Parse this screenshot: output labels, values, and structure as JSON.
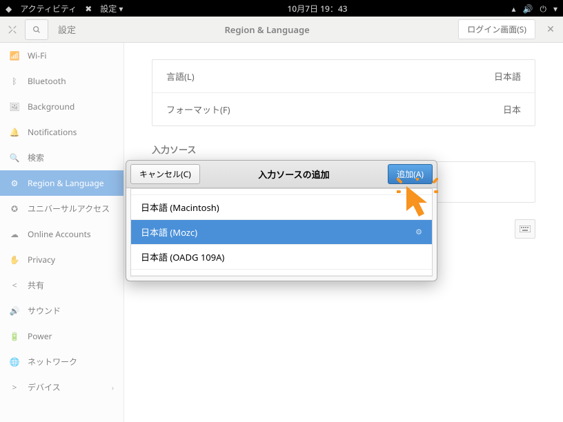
{
  "topbar": {
    "activities": "アクティビティ",
    "app": "設定",
    "datetime": "10月7日  19：43"
  },
  "titlebar": {
    "settings": "設定",
    "panel_title": "Region & Language",
    "login_screen": "ログイン画面(S)"
  },
  "sidebar": {
    "items": [
      {
        "icon": "wifi",
        "label": "Wi-Fi"
      },
      {
        "icon": "bt",
        "label": "Bluetooth"
      },
      {
        "icon": "bg",
        "label": "Background"
      },
      {
        "icon": "bell",
        "label": "Notifications"
      },
      {
        "icon": "search",
        "label": "検索"
      },
      {
        "icon": "globe",
        "label": "Region & Language"
      },
      {
        "icon": "a11y",
        "label": "ユニバーサルアクセス"
      },
      {
        "icon": "cloud",
        "label": "Online Accounts"
      },
      {
        "icon": "priv",
        "label": "Privacy"
      },
      {
        "icon": "share",
        "label": "共有"
      },
      {
        "icon": "sound",
        "label": "サウンド"
      },
      {
        "icon": "power",
        "label": "Power"
      },
      {
        "icon": "net",
        "label": "ネットワーク"
      },
      {
        "icon": "dev",
        "label": "デバイス"
      }
    ]
  },
  "main": {
    "language_label": "言語(L)",
    "language_value": "日本語",
    "format_label": "フォーマット(F)",
    "format_value": "日本",
    "input_sources_label": "入力ソース"
  },
  "dialog": {
    "cancel": "キャンセル(C)",
    "title": "入力ソースの追加",
    "add": "追加(A)",
    "rows": [
      {
        "label": "日本語 (Macintosh)"
      },
      {
        "label": "日本語 (Mozc)",
        "selected": true,
        "gear": true
      },
      {
        "label": "日本語 (OADG 109A)"
      }
    ]
  }
}
